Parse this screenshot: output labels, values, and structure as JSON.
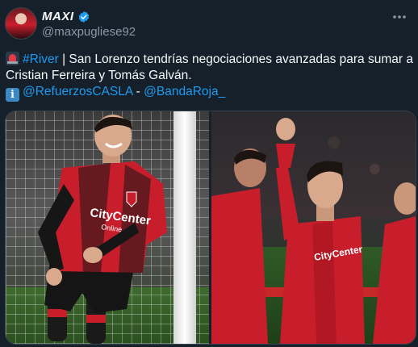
{
  "author": {
    "display_name": "MAXI",
    "handle": "@maxpugliese92",
    "verified": true
  },
  "tweet": {
    "line1_hashtag": "#River",
    "line1_rest": " | San Lorenzo tendrías negociaciones avanzadas para sumar a",
    "line2": "Cristian Ferreira y Tomás Galván.",
    "mention1": "@RefuerzosCASLA",
    "separator": " - ",
    "mention2": "@BandaRoja_"
  },
  "icons": {
    "siren": "rotating-light-emoji",
    "info": "information-emoji",
    "more": "more-dots-icon",
    "verified": "verified-badge-icon"
  },
  "colors": {
    "background": "#15202b",
    "link": "#1d9bf0",
    "secondary_text": "#8b98a5",
    "jersey_red": "#c81e2c"
  },
  "media": {
    "left_photo_text": "CityCenter",
    "left_photo_subtext": "Online",
    "right_photo_text": "CityCenter"
  }
}
